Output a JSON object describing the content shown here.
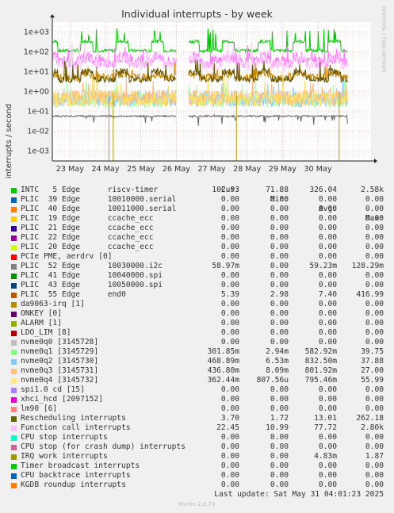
{
  "title": "Individual interrupts - by week",
  "side_label": "RRDTOOL / TOBI OETIKER",
  "chart_data": {
    "type": "line",
    "ylabel": "interrupts / second",
    "yscale": "log",
    "ylim": [
      0.0003,
      3000
    ],
    "yticks": [
      {
        "v": 1000,
        "label": "1e+03"
      },
      {
        "v": 100,
        "label": "1e+02"
      },
      {
        "v": 10,
        "label": "1e+01"
      },
      {
        "v": 1,
        "label": "1e+00"
      },
      {
        "v": 0.1,
        "label": "1e-01"
      },
      {
        "v": 0.01,
        "label": "1e-02"
      },
      {
        "v": 0.001,
        "label": "1e-03"
      }
    ],
    "xlim": [
      22.5,
      31.5
    ],
    "xticks": [
      {
        "v": 23,
        "label": "23 May"
      },
      {
        "v": 24,
        "label": "24 May"
      },
      {
        "v": 25,
        "label": "25 May"
      },
      {
        "v": 26,
        "label": "26 May"
      },
      {
        "v": 27,
        "label": "27 May"
      },
      {
        "v": 28,
        "label": "28 May"
      },
      {
        "v": 29,
        "label": "29 May"
      },
      {
        "v": 30,
        "label": "30 May"
      }
    ],
    "gap": [
      26.0,
      26.35
    ],
    "series": [
      {
        "name": "INTC   5 Edge      riscv-timer",
        "color": "#00cc00",
        "base": 110,
        "peak": 1500,
        "noise": 0.15,
        "day": true
      },
      {
        "name": "PLIC  52 Edge      10030000.i2c",
        "color": "#ff77ff",
        "base": 30,
        "peak": 150,
        "noise": 0.6,
        "day": true
      },
      {
        "name": "Function call interrupts",
        "color": "#ffc8ff",
        "base": 20,
        "peak": 200,
        "noise": 0.5,
        "day": true
      },
      {
        "name": "PLIC  55 Edge      end0",
        "color": "#cc8800",
        "base": 5,
        "peak": 20,
        "noise": 0.4,
        "day": true
      },
      {
        "name": "Rescheduling interrupts",
        "color": "#665500",
        "base": 4,
        "peak": 40,
        "noise": 0.35,
        "day": true
      },
      {
        "name": "nvme0q1 [3145729]",
        "color": "#aaffaa",
        "base": 0.35,
        "peak": 2,
        "noise": 0.8,
        "day": false
      },
      {
        "name": "nvme0q2 [3145730]",
        "color": "#88ccff",
        "base": 0.4,
        "peak": 2,
        "noise": 0.8,
        "day": false
      },
      {
        "name": "nvme0q3 [3145731]",
        "color": "#ffbb77",
        "base": 0.45,
        "peak": 2.5,
        "noise": 0.8,
        "day": false
      },
      {
        "name": "nvme0q4 [3145732]",
        "color": "#ffe066",
        "base": 0.4,
        "peak": 6,
        "noise": 0.8,
        "day": false
      },
      {
        "name": "CPU stop interrupts",
        "color": "#666666",
        "base": 0.055,
        "peak": 0.06,
        "noise": 0.08,
        "day": false
      }
    ]
  },
  "legend": {
    "headers": {
      "cur": "Cur:",
      "min": "Min:",
      "avg": "Avg:",
      "max": "Max:"
    },
    "rows": [
      {
        "name": "INTC   5 Edge      riscv-timer",
        "color": "#00cc00",
        "cur": "102.93",
        "min": "71.88",
        "avg": "326.04",
        "max": "2.58k"
      },
      {
        "name": "PLIC  39 Edge      10010000.serial",
        "color": "#0066b3",
        "cur": "0.00",
        "min": "0.00",
        "avg": "0.00",
        "max": "0.00"
      },
      {
        "name": "PLIC  40 Edge      10011000.serial",
        "color": "#ff8000",
        "cur": "0.00",
        "min": "0.00",
        "avg": "0.00",
        "max": "0.00"
      },
      {
        "name": "PLIC  19 Edge      ccache_ecc",
        "color": "#ffcc00",
        "cur": "0.00",
        "min": "0.00",
        "avg": "0.00",
        "max": "0.00"
      },
      {
        "name": "PLIC  21 Edge      ccache_ecc",
        "color": "#330099",
        "cur": "0.00",
        "min": "0.00",
        "avg": "0.00",
        "max": "0.00"
      },
      {
        "name": "PLIC  22 Edge      ccache_ecc",
        "color": "#990099",
        "cur": "0.00",
        "min": "0.00",
        "avg": "0.00",
        "max": "0.00"
      },
      {
        "name": "PLIC  20 Edge      ccache_ecc",
        "color": "#ccff00",
        "cur": "0.00",
        "min": "0.00",
        "avg": "0.00",
        "max": "0.00"
      },
      {
        "name": "PCIe PME, aerdrv [0]",
        "color": "#ff0000",
        "cur": "0.00",
        "min": "0.00",
        "avg": "0.00",
        "max": "0.00"
      },
      {
        "name": "PLIC  52 Edge      10030000.i2c",
        "color": "#808080",
        "cur": "58.97m",
        "min": "0.00",
        "avg": "59.23m",
        "max": "128.29m"
      },
      {
        "name": "PLIC  41 Edge      10040000.spi",
        "color": "#008f00",
        "cur": "0.00",
        "min": "0.00",
        "avg": "0.00",
        "max": "0.00"
      },
      {
        "name": "PLIC  43 Edge      10050000.spi",
        "color": "#00487d",
        "cur": "0.00",
        "min": "0.00",
        "avg": "0.00",
        "max": "0.00"
      },
      {
        "name": "PLIC  55 Edge      end0",
        "color": "#b35a00",
        "cur": "5.39",
        "min": "2.98",
        "avg": "7.40",
        "max": "416.99"
      },
      {
        "name": "da9063-irq [1]",
        "color": "#b38f00",
        "cur": "0.00",
        "min": "0.00",
        "avg": "0.00",
        "max": "0.00"
      },
      {
        "name": "ONKEY [0]",
        "color": "#6b006b",
        "cur": "0.00",
        "min": "0.00",
        "avg": "0.00",
        "max": "0.00"
      },
      {
        "name": "ALARM [1]",
        "color": "#8fb300",
        "cur": "0.00",
        "min": "0.00",
        "avg": "0.00",
        "max": "0.00"
      },
      {
        "name": "LDO_LIM [8]",
        "color": "#b30000",
        "cur": "0.00",
        "min": "0.00",
        "avg": "0.00",
        "max": "0.00"
      },
      {
        "name": "nvme0q0 [3145728]",
        "color": "#bebebe",
        "cur": "0.00",
        "min": "0.00",
        "avg": "0.00",
        "max": "0.00"
      },
      {
        "name": "nvme0q1 [3145729]",
        "color": "#80ff80",
        "cur": "301.85m",
        "min": "2.94m",
        "avg": "582.92m",
        "max": "39.75"
      },
      {
        "name": "nvme0q2 [3145730]",
        "color": "#80c9ff",
        "cur": "468.89m",
        "min": "6.53m",
        "avg": "832.50m",
        "max": "37.88"
      },
      {
        "name": "nvme0q3 [3145731]",
        "color": "#ffc080",
        "cur": "436.80m",
        "min": "8.09m",
        "avg": "801.92m",
        "max": "27.00"
      },
      {
        "name": "nvme0q4 [3145732]",
        "color": "#ffe680",
        "cur": "362.44m",
        "min": "807.56u",
        "avg": "795.46m",
        "max": "55.99"
      },
      {
        "name": "spi1.0 cd [15]",
        "color": "#aa80ff",
        "cur": "0.00",
        "min": "0.00",
        "avg": "0.00",
        "max": "0.00"
      },
      {
        "name": "xhci_hcd [2097152]",
        "color": "#ee00cc",
        "cur": "0.00",
        "min": "0.00",
        "avg": "0.00",
        "max": "0.00"
      },
      {
        "name": "lm90 [6]",
        "color": "#ff8080",
        "cur": "0.00",
        "min": "0.00",
        "avg": "0.00",
        "max": "0.00"
      },
      {
        "name": "Rescheduling interrupts",
        "color": "#666600",
        "cur": "3.70",
        "min": "1.72",
        "avg": "13.01",
        "max": "262.18"
      },
      {
        "name": "Function call interrupts",
        "color": "#ffbfff",
        "cur": "22.45",
        "min": "10.99",
        "avg": "77.72",
        "max": "2.80k"
      },
      {
        "name": "CPU stop interrupts",
        "color": "#00ffcc",
        "cur": "0.00",
        "min": "0.00",
        "avg": "0.00",
        "max": "0.00"
      },
      {
        "name": "CPU stop (for crash dump) interrupts",
        "color": "#cc6699",
        "cur": "0.00",
        "min": "0.00",
        "avg": "0.00",
        "max": "0.00"
      },
      {
        "name": "IRQ work interrupts",
        "color": "#999900",
        "cur": "0.00",
        "min": "0.00",
        "avg": "4.83m",
        "max": "1.87"
      },
      {
        "name": "Timer broadcast interrupts",
        "color": "#00cc00",
        "cur": "0.00",
        "min": "0.00",
        "avg": "0.00",
        "max": "0.00"
      },
      {
        "name": "CPU backtrace interrupts",
        "color": "#0066b3",
        "cur": "0.00",
        "min": "0.00",
        "avg": "0.00",
        "max": "0.00"
      },
      {
        "name": "KGDB roundup interrupts",
        "color": "#ff8000",
        "cur": "0.00",
        "min": "0.00",
        "avg": "0.00",
        "max": "0.00"
      }
    ]
  },
  "last_update": "Last update: Sat May 31 04:01:23 2025",
  "footer": "Munin 2.0.73"
}
